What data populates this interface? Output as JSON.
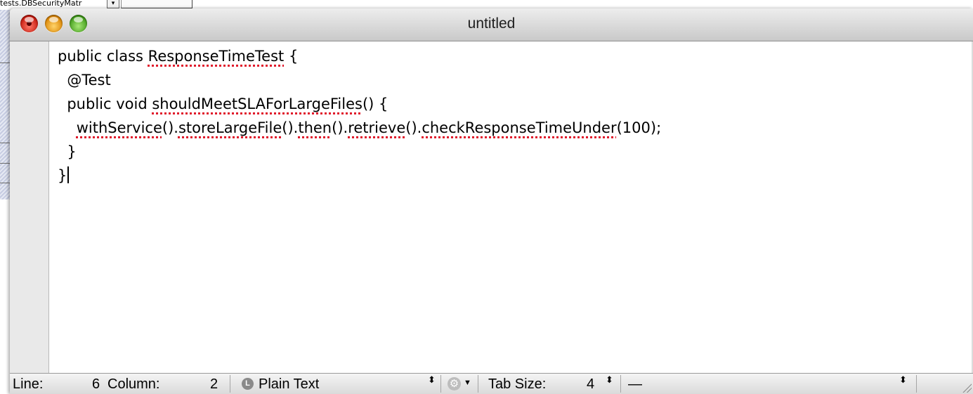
{
  "background_app": {
    "field_label": "tests.DBSecurityMatr",
    "popup_arrow": "▾"
  },
  "window": {
    "title": "untitled"
  },
  "editor": {
    "lines": {
      "l1_a": "public class ",
      "l1_b": "ResponseTimeTest",
      "l1_c": " {",
      "l2": "  @Test",
      "l3_a": "  public void ",
      "l3_b": "shouldMeetSLAForLargeFiles",
      "l3_c": "() {",
      "l4_indent": "    ",
      "l4_a": "withService",
      "l4_b": "().",
      "l4_c": "storeLargeFile",
      "l4_d": "().",
      "l4_e": "then",
      "l4_f": "().",
      "l4_g": "retrieve",
      "l4_h": "().",
      "l4_i": "checkResponseTimeUnder",
      "l4_j": "(100);",
      "l5": "  }",
      "l6": "}"
    }
  },
  "statusbar": {
    "line_label": "Line:",
    "line_value": "6",
    "column_label": "Column:",
    "column_value": "2",
    "language_icon_glyph": "L",
    "language": "Plain Text",
    "tab_size_label": "Tab Size:",
    "tab_size_value": "4",
    "symbol_value": "—",
    "stepper_glyph": "⬍",
    "gear_glyph": "⚙",
    "menu_arrow": "▼"
  },
  "colors": {
    "spell_underline": "#e0192b",
    "close_button": "#d6281a",
    "minimize_button": "#f2a30f",
    "zoom_button": "#5cb82c"
  },
  "icons": [
    "close-window-icon",
    "minimize-window-icon",
    "zoom-window-icon",
    "language-icon",
    "gear-icon",
    "chevron-down-icon",
    "stepper-icon",
    "resize-grip-icon"
  ]
}
